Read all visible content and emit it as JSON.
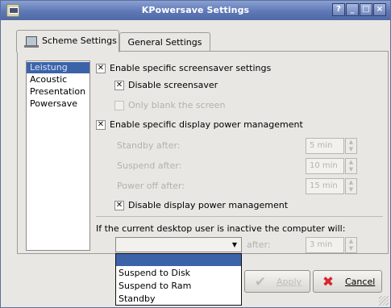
{
  "window": {
    "title": "KPowersave Settings",
    "controls": [
      "?",
      "_",
      "□",
      "×"
    ]
  },
  "tabs": [
    {
      "label": "Scheme Settings",
      "active": true
    },
    {
      "label": "General Settings",
      "active": false
    }
  ],
  "schemes": {
    "items": [
      "Leistung",
      "Acoustic",
      "Presentation",
      "Powersave"
    ],
    "selected": "Leistung"
  },
  "options": {
    "enable_screensaver": {
      "label": "Enable specific screensaver settings",
      "checked": true
    },
    "disable_screensaver": {
      "label": "Disable screensaver",
      "checked": true
    },
    "only_blank": {
      "label": "Only blank the screen",
      "checked": false,
      "enabled": false
    },
    "enable_display_pm": {
      "label": "Enable specific display power management",
      "checked": true
    },
    "standby_after": {
      "label": "Standby after:",
      "value": "5 min"
    },
    "suspend_after": {
      "label": "Suspend after:",
      "value": "10 min"
    },
    "power_off_after": {
      "label": "Power off after:",
      "value": "15 min"
    },
    "disable_display_pm": {
      "label": "Disable display power management",
      "checked": true
    }
  },
  "inactive": {
    "label": "If the current desktop user is inactive the computer will:",
    "after_label": "after:",
    "after_value": "3 min",
    "selected_action": "",
    "dropdown_options": [
      "Suspend to Disk",
      "Suspend to Ram",
      "Standby"
    ]
  },
  "buttons": {
    "apply": "Apply",
    "cancel": "Cancel"
  },
  "colors": {
    "title_bar": "#5f78b6",
    "selection": "#3c63a8",
    "cancel_icon": "#d9262e"
  }
}
